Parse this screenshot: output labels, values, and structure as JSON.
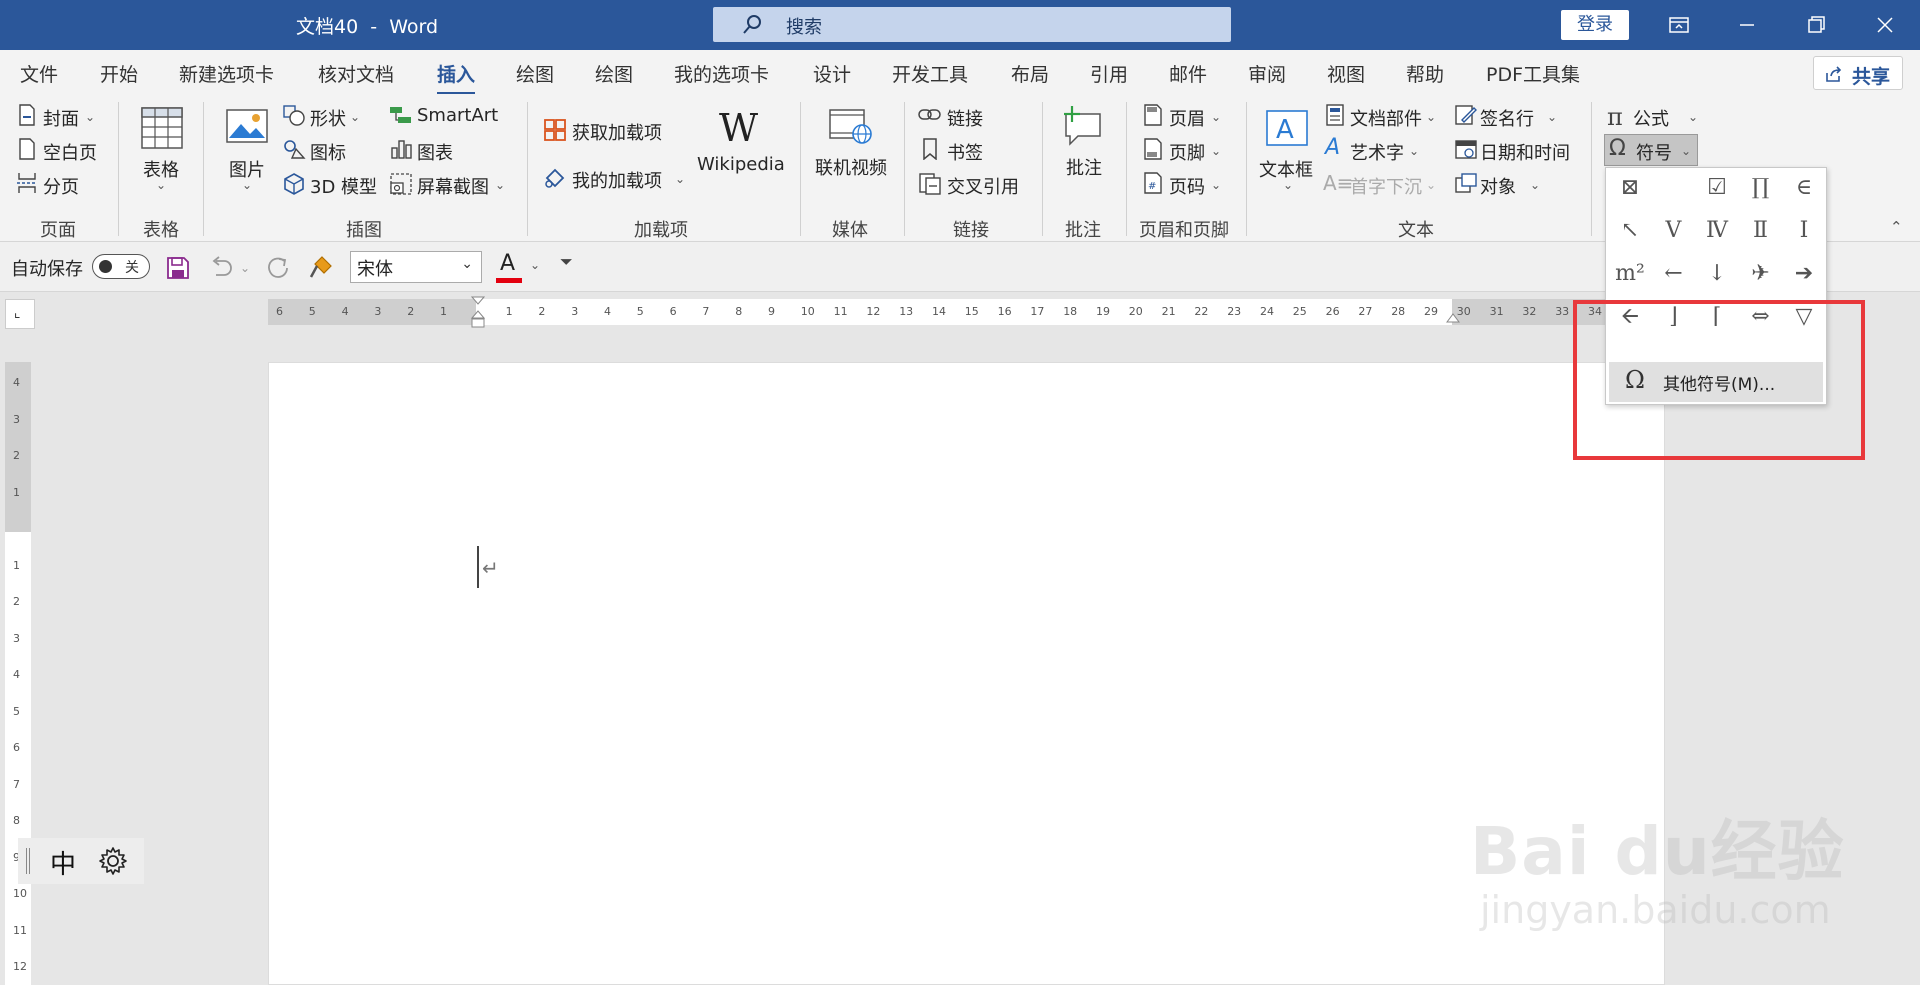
{
  "titlebar": {
    "title": "文档40  -  Word",
    "search_placeholder": "搜索",
    "login_label": "登录"
  },
  "tabs": [
    "文件",
    "开始",
    "新建选项卡",
    "核对文档",
    "插入",
    "绘图",
    "绘图",
    "我的选项卡",
    "设计",
    "开发工具",
    "布局",
    "引用",
    "邮件",
    "审阅",
    "视图",
    "帮助",
    "PDF工具集"
  ],
  "active_tab": "插入",
  "share_label": "共享",
  "ribbon": {
    "page": {
      "cover": "封面",
      "blank": "空白页",
      "break": "分页",
      "group": "页面"
    },
    "table": {
      "label": "表格",
      "group": "表格"
    },
    "illustrations": {
      "picture": "图片",
      "shapes": "形状",
      "icons": "图标",
      "model3d": "3D 模型",
      "smartart": "SmartArt",
      "chart": "图表",
      "screenshot": "屏幕截图",
      "group": "插图"
    },
    "addins": {
      "get": "获取加载项",
      "mine": "我的加载项",
      "wikipedia": "Wikipedia",
      "group": "加载项"
    },
    "media": {
      "video": "联机视频",
      "group": "媒体"
    },
    "links": {
      "link": "链接",
      "bookmark": "书签",
      "cross": "交叉引用",
      "group": "链接"
    },
    "comments": {
      "comment": "批注",
      "group": "批注"
    },
    "headerfooter": {
      "header": "页眉",
      "footer": "页脚",
      "pagenum": "页码",
      "group": "页眉和页脚"
    },
    "text": {
      "textbox": "文本框",
      "parts": "文档部件",
      "wordart": "艺术字",
      "dropcap": "首字下沉",
      "sigline": "签名行",
      "datetime": "日期和时间",
      "object": "对象",
      "group": "文本"
    },
    "symbols": {
      "equation": "公式",
      "symbol": "符号"
    }
  },
  "qat": {
    "autosave": "自动保存",
    "toggle": "关",
    "font": "宋体"
  },
  "ruler_h_labels": [
    "6",
    "5",
    "4",
    "3",
    "2",
    "1",
    "",
    "1",
    "2",
    "3",
    "4",
    "5",
    "6",
    "7",
    "8",
    "9",
    "10",
    "11",
    "12",
    "13",
    "14",
    "15",
    "16",
    "17",
    "18",
    "19",
    "20",
    "21",
    "22",
    "23",
    "24",
    "25",
    "26",
    "27",
    "28",
    "29",
    "30",
    "31",
    "32",
    "33",
    "34"
  ],
  "ruler_v_labels": [
    "4",
    "3",
    "2",
    "1",
    "",
    "1",
    "2",
    "3",
    "4",
    "5",
    "6",
    "7",
    "8",
    "9",
    "10",
    "11",
    "12"
  ],
  "symbol_panel": {
    "symbols": [
      "⊠",
      "",
      "☑",
      "∏",
      "∈",
      "↖",
      "Ⅴ",
      "Ⅳ",
      "Ⅱ",
      "Ⅰ",
      "m²",
      "←",
      "↓",
      "✈",
      "➔",
      "🡨",
      "⌋",
      "⌈",
      "⇔",
      "▽"
    ],
    "more_label": "其他符号(M)..."
  },
  "ime": {
    "mode": "中"
  },
  "watermark": {
    "main": "Bai du经验",
    "sub": "jingyan.baidu.com"
  },
  "colors": {
    "brand": "#2b579a",
    "highlight": "#e8383b"
  }
}
